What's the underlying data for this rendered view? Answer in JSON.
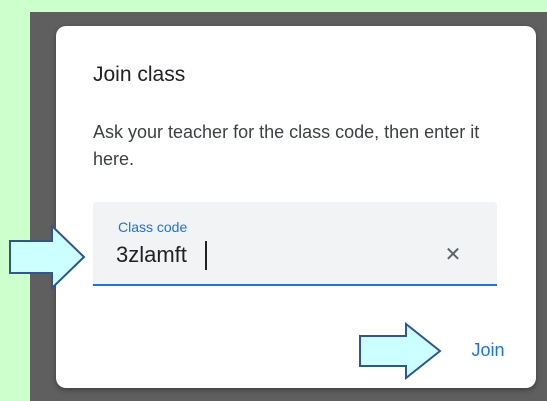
{
  "dialog": {
    "title": "Join class",
    "description": "Ask your teacher for the class code, then enter it here."
  },
  "field": {
    "label": "Class code",
    "value": "3zlamft",
    "clear_icon": "close-icon",
    "clear_glyph": "✕"
  },
  "actions": {
    "join_label": "Join"
  },
  "colors": {
    "accent": "#1a73e8",
    "page_background": "#ccffcc",
    "scrim": "#5f5f5f",
    "annotation_arrow_fill": "#ccffff",
    "annotation_arrow_stroke": "#2f5597"
  }
}
